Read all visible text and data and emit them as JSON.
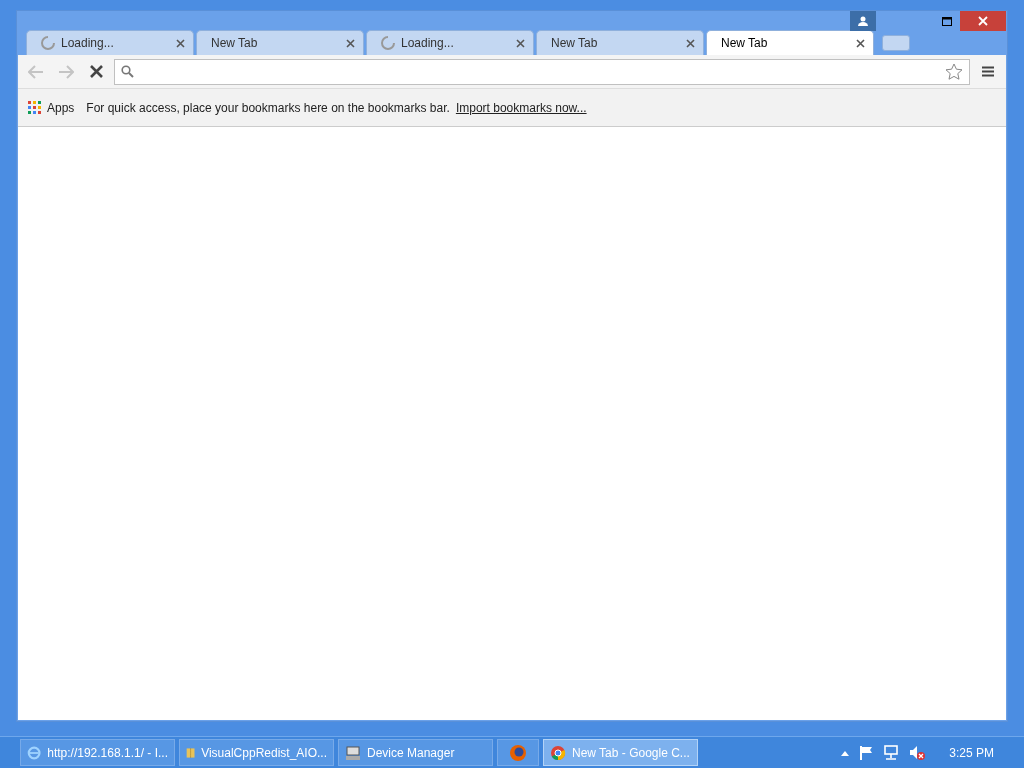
{
  "tabs": [
    {
      "title": "Loading...",
      "loading": true,
      "selected": false
    },
    {
      "title": "New Tab",
      "loading": false,
      "selected": false
    },
    {
      "title": "Loading...",
      "loading": true,
      "selected": false
    },
    {
      "title": "New Tab",
      "loading": false,
      "selected": false
    },
    {
      "title": "New Tab",
      "loading": false,
      "selected": true
    }
  ],
  "toolbar": {
    "back_disabled": true,
    "forward_disabled": true,
    "loading": true
  },
  "bookmarks_bar": {
    "apps_label": "Apps",
    "message": "For quick access, place your bookmarks here on the bookmarks bar.",
    "import_link": "Import bookmarks now..."
  },
  "taskbar": {
    "items": [
      {
        "kind": "browser",
        "label": "http://192.168.1.1/ - I...",
        "selected": false
      },
      {
        "kind": "archive",
        "label": "VisualCppRedist_AIO...",
        "selected": false
      },
      {
        "kind": "device",
        "label": "Device Manager",
        "selected": false
      },
      {
        "kind": "firefox",
        "selected": false
      },
      {
        "kind": "chrome",
        "label": "New Tab - Google C...",
        "selected": true
      }
    ],
    "clock": "3:25 PM"
  }
}
